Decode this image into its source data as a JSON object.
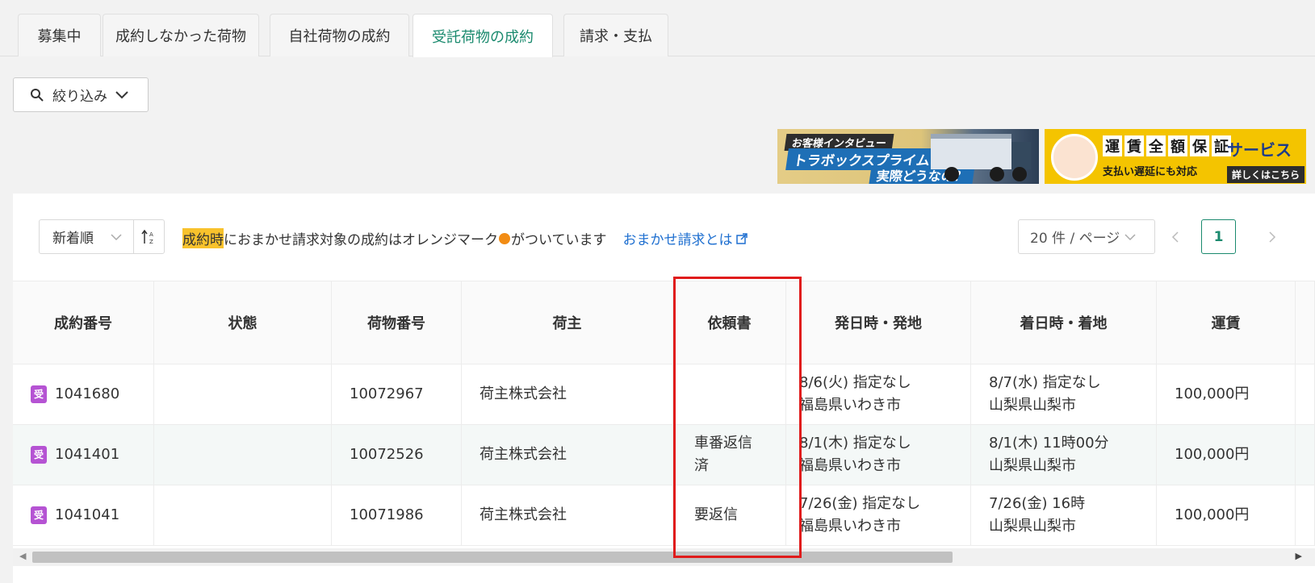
{
  "tabs": [
    {
      "label": "募集中"
    },
    {
      "label": "成約しなかった荷物"
    },
    {
      "label": "自社荷物の成約"
    },
    {
      "label": "受託荷物の成約",
      "active": true
    },
    {
      "label": "請求・支払"
    }
  ],
  "filter": {
    "label": "絞り込み"
  },
  "banners": {
    "interview": {
      "top": "お客様インタビュー",
      "middle": "トラボックスプライムって",
      "bottom": "実際どうなの？"
    },
    "guarantee": {
      "chars": [
        "運",
        "賃",
        "全",
        "額",
        "保",
        "証"
      ],
      "service": "サービス",
      "sub": "支払い遅延にも対応",
      "more": "詳しくはこちら"
    }
  },
  "toolbar": {
    "sort_label": "新着順",
    "notice_highlight": "成約時",
    "notice_before": "におまかせ請求対象の成約はオレンジマーク",
    "notice_after": "がついています",
    "notice_link": "おまかせ請求とは",
    "per_page": "20 件 / ページ",
    "current_page": "1"
  },
  "table": {
    "headers": [
      "成約番号",
      "状態",
      "荷物番号",
      "荷主",
      "依頼書",
      "発日時・発地",
      "着日時・着地",
      "運賃"
    ],
    "rows": [
      {
        "badge": "受",
        "contract_no": "1041680",
        "status": "",
        "cargo_no": "10072967",
        "shipper": "荷主株式会社",
        "request": "",
        "depart_time": "8/6(火) 指定なし",
        "depart_place": "福島県いわき市",
        "arrive_time": "8/7(水) 指定なし",
        "arrive_place": "山梨県山梨市",
        "fare": "100,000円"
      },
      {
        "badge": "受",
        "contract_no": "1041401",
        "status": "",
        "cargo_no": "10072526",
        "shipper": "荷主株式会社",
        "request_l1": "車番返信",
        "request_l2": "済",
        "depart_time": "8/1(木) 指定なし",
        "depart_place": "福島県いわき市",
        "arrive_time": "8/1(木) 11時00分",
        "arrive_place": "山梨県山梨市",
        "fare": "100,000円"
      },
      {
        "badge": "受",
        "contract_no": "1041041",
        "status": "",
        "cargo_no": "10071986",
        "shipper": "荷主株式会社",
        "request": "要返信",
        "depart_time": "7/26(金) 指定なし",
        "depart_place": "福島県いわき市",
        "arrive_time": "7/26(金) 16時",
        "arrive_place": "山梨県山梨市",
        "fare": "100,000円"
      }
    ]
  },
  "colors": {
    "accent": "#1a8a6e",
    "highlight_box": "#e01c1c",
    "orange_mark": "#f28c14",
    "badge": "#b553d3",
    "link": "#1e6fd0"
  }
}
